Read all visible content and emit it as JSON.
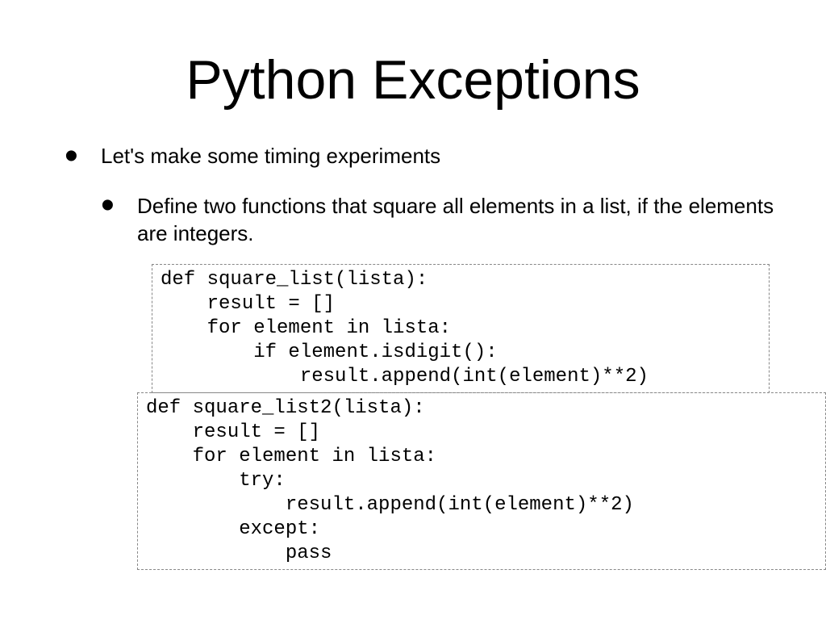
{
  "slide": {
    "title": "Python Exceptions",
    "bullet1": "Let's make some timing experiments",
    "bullet2": "Define two functions that square all elements in a list, if the elements are integers.",
    "code1": "def square_list(lista):\n    result = []\n    for element in lista:\n        if element.isdigit():\n            result.append(int(element)**2)",
    "code2": "def square_list2(lista):\n    result = []\n    for element in lista:\n        try:\n            result.append(int(element)**2)\n        except:\n            pass"
  }
}
